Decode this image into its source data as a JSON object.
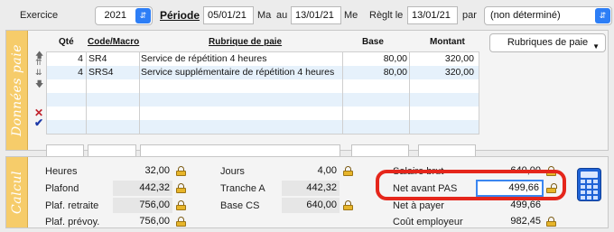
{
  "header": {
    "exercice_label": "Exercice",
    "exercice_value": "2021",
    "periode_label": "Période",
    "date_from": "05/01/21",
    "day_from": "Ma",
    "au_label": "au",
    "date_to": "13/01/21",
    "day_to": "Me",
    "reglt_label": "Règlt le",
    "reglt_date": "13/01/21",
    "par_label": "par",
    "par_value": "(non déterminé)"
  },
  "donnees": {
    "tab_label": "Données paie",
    "columns": {
      "qte": "Qté",
      "code": "Code/Macro",
      "rubrique": "Rubrique de paie",
      "base": "Base",
      "montant": "Montant"
    },
    "rows": [
      {
        "qte": "4",
        "code": "SR4",
        "rubrique": "Service de répétition 4 heures",
        "base": "80,00",
        "montant": "320,00"
      },
      {
        "qte": "4",
        "code": "SRS4",
        "rubrique": "Service supplémentaire de répétition 4 heures",
        "base": "80,00",
        "montant": "320,00"
      }
    ],
    "rubriques_button": "Rubriques de paie"
  },
  "calcul": {
    "tab_label": "Calcul",
    "heures_label": "Heures",
    "heures_value": "32,00",
    "plafond_label": "Plafond",
    "plafond_value": "442,32",
    "plaf_retraite_label": "Plaf. retraite",
    "plaf_retraite_value": "756,00",
    "plaf_prevoy_label": "Plaf. prévoy.",
    "plaf_prevoy_value": "756,00",
    "jours_label": "Jours",
    "jours_value": "4,00",
    "tranche_a_label": "Tranche A",
    "tranche_a_value": "442,32",
    "base_cs_label": "Base CS",
    "base_cs_value": "640,00",
    "salaire_brut_label": "Salaire brut",
    "salaire_brut_value": "640,00",
    "net_avant_pas_label": "Net avant PAS",
    "net_avant_pas_value": "499,66",
    "net_a_payer_label": "Net à payer",
    "net_a_payer_value": "499,66",
    "cout_employeur_label": "Coût employeur",
    "cout_employeur_value": "982,45"
  },
  "colors": {
    "accent": "#2d7ef6",
    "tab": "#f6cc6a",
    "highlight": "#e5261b",
    "row_alt": "#e6f1fb"
  },
  "icons": [
    "select-arrows-icon",
    "lock-icon",
    "calculator-icon",
    "up-arrow-icon",
    "down-arrow-icon",
    "delete-icon",
    "validate-icon"
  ]
}
